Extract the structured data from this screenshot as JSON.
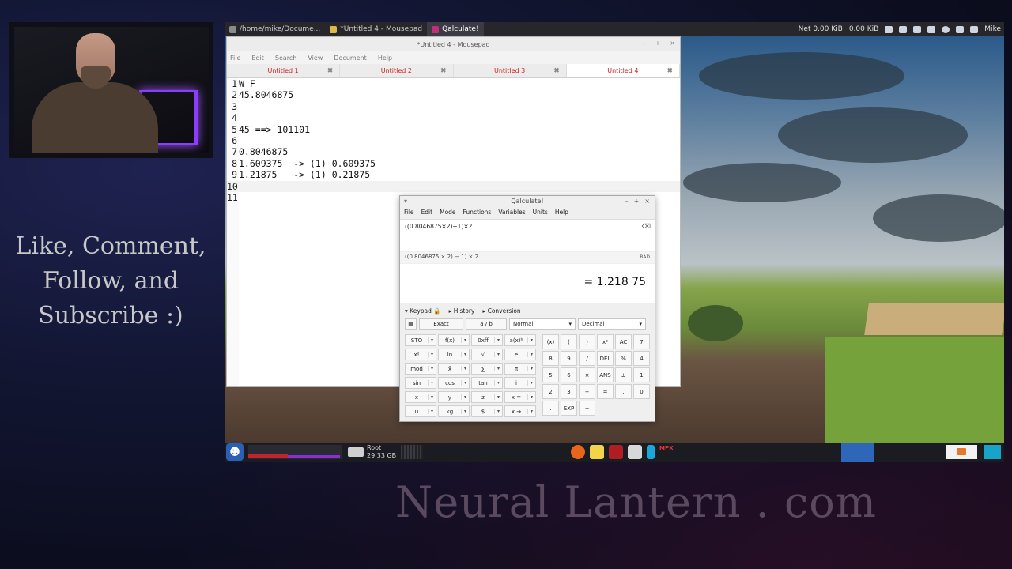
{
  "overlay": {
    "promo_lines": [
      "Like, Comment,",
      "Follow, and",
      "Subscribe :)"
    ],
    "site": "Neural Lantern . com"
  },
  "topbar": {
    "tasks": [
      {
        "label": "/home/mike/Docume..."
      },
      {
        "label": "*Untitled 4 - Mousepad"
      },
      {
        "label": "Qalculate!"
      }
    ],
    "net": "Net 0.00 KiB",
    "net2": "0.00 KiB",
    "user": "Mike"
  },
  "mousepad": {
    "title": "*Untitled 4 - Mousepad",
    "menu": [
      "File",
      "Edit",
      "Search",
      "View",
      "Document",
      "Help"
    ],
    "tabs": [
      "Untitled 1",
      "Untitled 2",
      "Untitled 3",
      "Untitled 4"
    ],
    "lines": [
      {
        "n": "1",
        "t": "W F"
      },
      {
        "n": "2",
        "t": "45.8046875"
      },
      {
        "n": "3",
        "t": ""
      },
      {
        "n": "4",
        "t": ""
      },
      {
        "n": "5",
        "t": "45 ==> 101101"
      },
      {
        "n": "6",
        "t": ""
      },
      {
        "n": "7",
        "t": "0.8046875"
      },
      {
        "n": "8",
        "t": "1.609375  -> (1) 0.609375"
      },
      {
        "n": "9",
        "t": "1.21875   -> (1) 0.21875"
      },
      {
        "n": "10",
        "t": ""
      },
      {
        "n": "11",
        "t": ""
      }
    ]
  },
  "taskbar": {
    "drive_name": "Root",
    "drive_size": "29.33 GB",
    "mpx_label": "MPX"
  },
  "qalc": {
    "title": "Qalculate!",
    "menu": [
      "File",
      "Edit",
      "Mode",
      "Functions",
      "Variables",
      "Units",
      "Help"
    ],
    "expression": "((0.8046875×2)−1)×2",
    "parsed": "((0.8046875 × 2) − 1) × 2",
    "angle": "RAD",
    "result": "= 1.218 75",
    "sections": [
      "Keypad",
      "History",
      "Conversion"
    ],
    "exact": "Exact",
    "fraction": "a / b",
    "mode": "Normal",
    "base": "Decimal",
    "fn_keys": [
      "STO",
      "f(x)",
      "0xff",
      "a(x)ᵇ",
      "x!",
      "ln",
      "√",
      "e",
      "mod",
      "x̄",
      "∑",
      "π",
      "sin",
      "cos",
      "tan",
      "i",
      "x",
      "y",
      "z",
      "x =",
      "u",
      "kg",
      "$",
      "x →"
    ],
    "num_keys": [
      "(x)",
      "(",
      ")",
      "x²",
      "AC",
      "7",
      "8",
      "9",
      "/",
      "DEL",
      "%",
      "4",
      "5",
      "6",
      "×",
      "ANS",
      "±",
      "1",
      "2",
      "3",
      "−",
      "=",
      ".",
      "0",
      ".",
      "EXP",
      "+",
      ""
    ]
  }
}
